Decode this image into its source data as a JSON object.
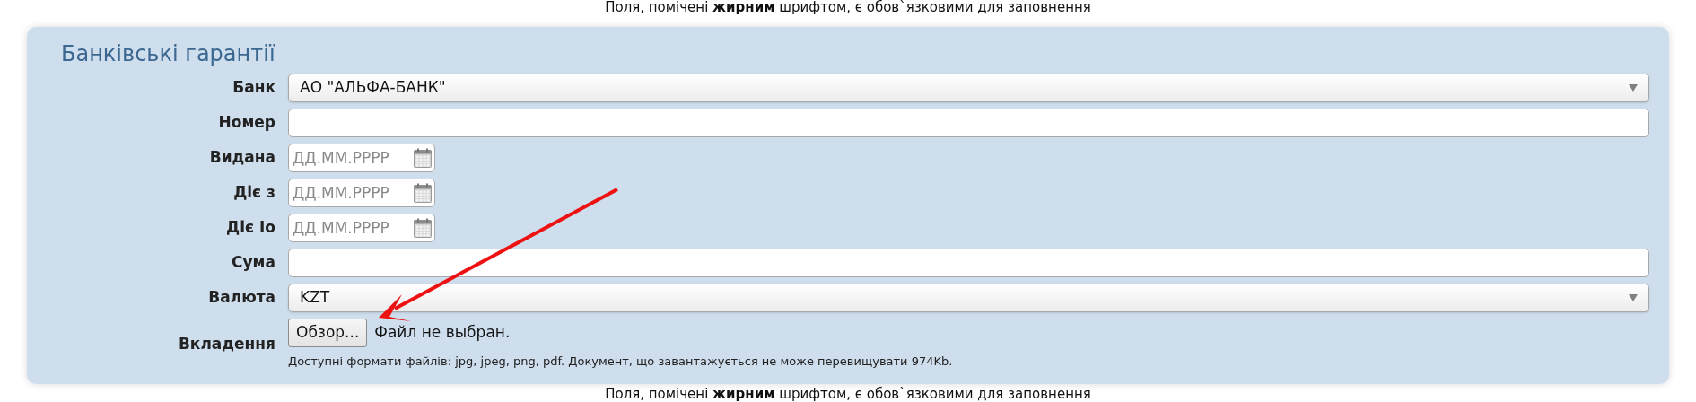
{
  "top_notice": "Поля, помічені **жирним** шрифтом, є обов`язковими для заповнення",
  "panel": {
    "title": "Банківські гарантії",
    "fields": [
      {
        "kind": "select",
        "label": "Банк",
        "value": "АО \"АЛЬФА-БАНК\""
      },
      {
        "kind": "text",
        "label": "Номер"
      },
      {
        "kind": "date",
        "label": "Видана",
        "placeholder": "ДД.ММ.РРРР"
      },
      {
        "kind": "date",
        "label": "Діє з",
        "placeholder": "ДД.ММ.РРРР"
      },
      {
        "kind": "date",
        "label": "Діє Іо",
        "placeholder": "ДД.ММ.РРРР"
      },
      {
        "kind": "text",
        "label": "Сума"
      },
      {
        "kind": "select",
        "label": "Валюта",
        "value": "KZT"
      },
      {
        "kind": "file",
        "label": "Вкладення",
        "button": "Обзор...",
        "status": "Файл не выбран.",
        "hint": "Доступні формати файлів: jpg, jpeg, png, pdf. Документ, що завантажується не може перевищувати 974Kb."
      }
    ]
  },
  "bottom_notice": "Поля, помічені **жирним** шрифтом, є обов`язковими для заповнення"
}
